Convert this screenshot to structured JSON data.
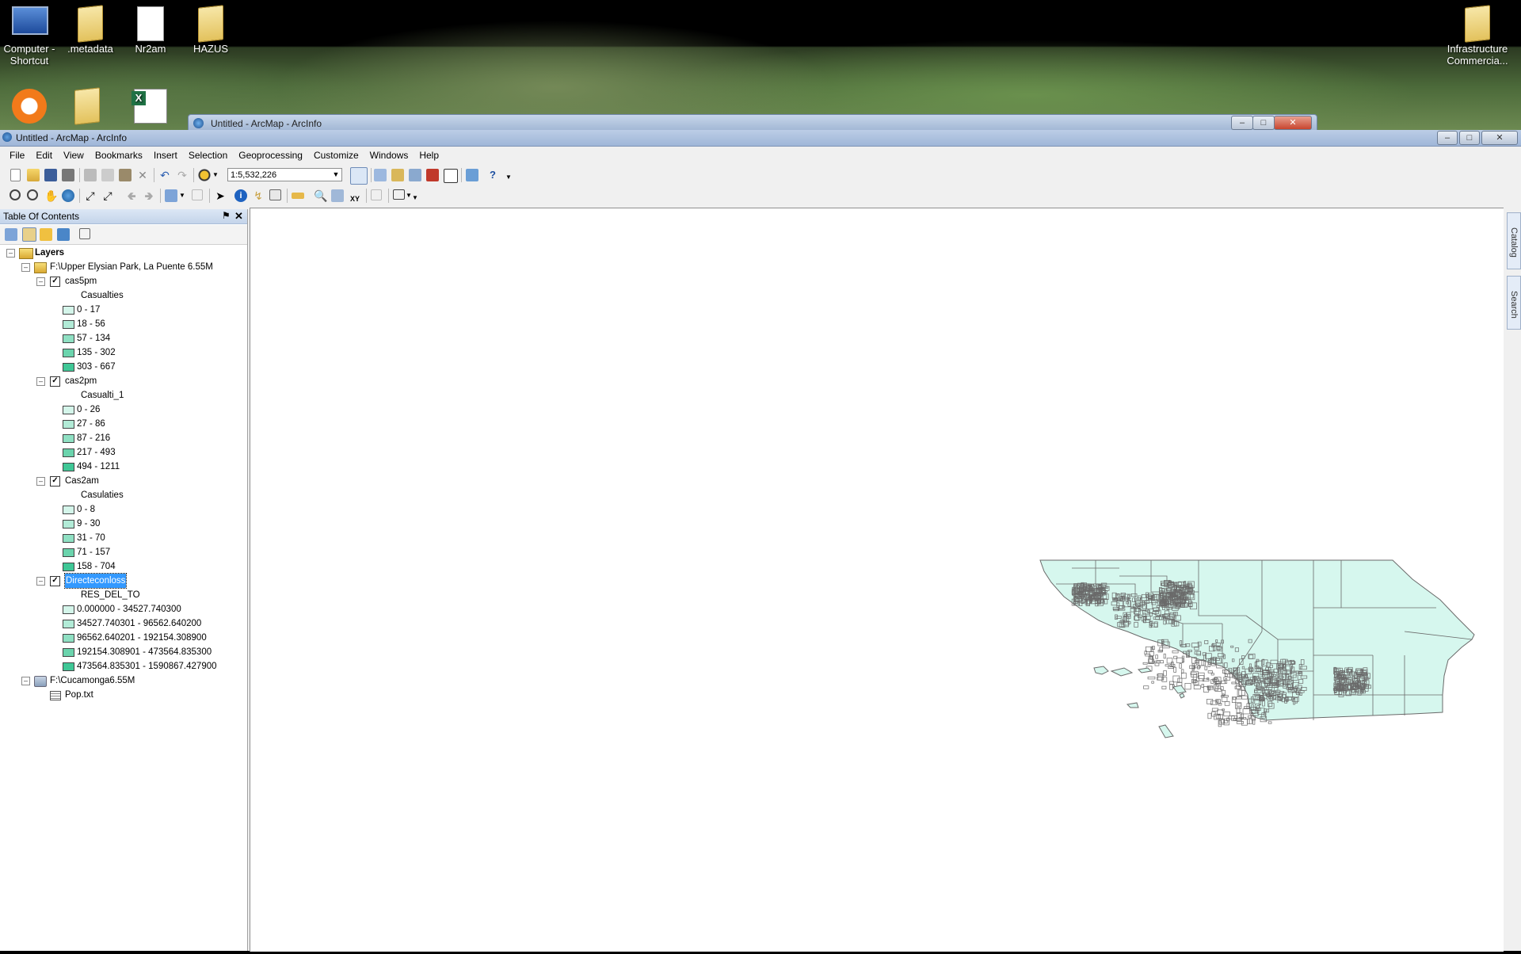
{
  "desktop": {
    "icons": [
      {
        "label": "Computer - Shortcut",
        "icon": "computer-icon"
      },
      {
        "label": ".metadata",
        "icon": "folder-icon"
      },
      {
        "label": "Nr2am",
        "icon": "document-icon"
      },
      {
        "label": "HAZUS",
        "icon": "folder-icon"
      },
      {
        "label": "Infrastructure Commercia...",
        "icon": "folder-icon"
      },
      {
        "label": "",
        "icon": "avast-icon"
      },
      {
        "label": "",
        "icon": "folder-icon"
      },
      {
        "label": "",
        "icon": "excel-icon"
      }
    ]
  },
  "background_window": {
    "title": "Untitled - ArcMap - ArcInfo"
  },
  "window": {
    "title": "Untitled - ArcMap - ArcInfo"
  },
  "menu": [
    "File",
    "Edit",
    "View",
    "Bookmarks",
    "Insert",
    "Selection",
    "Geoprocessing",
    "Customize",
    "Windows",
    "Help"
  ],
  "toolbar": {
    "scale": "1:5,532,226"
  },
  "toc": {
    "title": "Table Of Contents",
    "root": "Layers",
    "groups": [
      {
        "name": "F:\\Upper Elysian Park, La Puente 6.55M",
        "layers": [
          {
            "name": "cas5pm",
            "field": "Casualties",
            "checked": true,
            "classes": [
              "0 - 17",
              "18 - 56",
              "57 - 134",
              "135 - 302",
              "303 - 667"
            ]
          },
          {
            "name": "cas2pm",
            "field": "Casualti_1",
            "checked": true,
            "classes": [
              "0 - 26",
              "27 - 86",
              "87 - 216",
              "217 - 493",
              "494 - 1211"
            ]
          },
          {
            "name": "Cas2am",
            "field": "Casulaties",
            "checked": true,
            "classes": [
              "0 - 8",
              "9 - 30",
              "31 - 70",
              "71 - 157",
              "158 - 704"
            ]
          },
          {
            "name": "Directeconloss",
            "field": "RES_DEL_TO",
            "checked": true,
            "selected": true,
            "classes": [
              "0.000000 - 34527.740300",
              "34527.740301 - 96562.640200",
              "96562.640201 - 192154.308900",
              "192154.308901 - 473564.835300",
              "473564.835301 - 1590867.427900"
            ]
          }
        ]
      },
      {
        "name": "F:\\Cucamonga6.55M",
        "tables": [
          "Pop.txt"
        ]
      }
    ],
    "class_colors": [
      "#d4f5ea",
      "#b2ebd7",
      "#8fe0c3",
      "#6bd4ad",
      "#3fc796"
    ]
  },
  "side_tabs": [
    "Catalog",
    "Search"
  ],
  "map": {
    "fill": "#d6f7ee",
    "stroke": "#6a6a6a"
  }
}
